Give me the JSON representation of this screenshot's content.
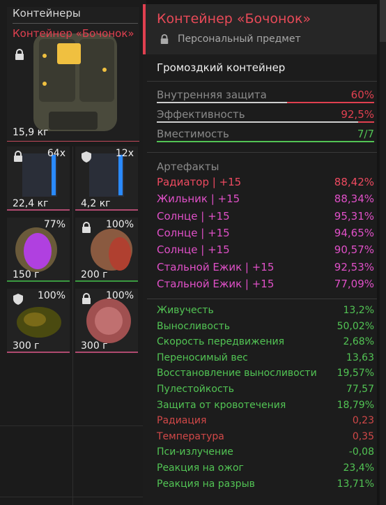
{
  "left": {
    "section_title": "Контейнеры",
    "selected_name": "Контейнер «Бочонок»",
    "selected_weight": "15,9 кг",
    "slots": [
      {
        "weight": "22,4 кг",
        "count": "64x",
        "icon": "lock-icon"
      },
      {
        "weight": "4,2 кг",
        "count": "12x",
        "icon": "shield-icon"
      },
      {
        "weight": "150 г",
        "count": "77%",
        "icon": "none"
      },
      {
        "weight": "200 г",
        "count": "100%",
        "icon": "lock-icon"
      },
      {
        "weight": "300 г",
        "count": "100%",
        "icon": "shield-icon"
      },
      {
        "weight": "300 г",
        "count": "100%",
        "icon": "lock-icon"
      }
    ]
  },
  "panel": {
    "title": "Контейнер «Бочонок»",
    "subtitle": "Персональный предмет",
    "type_label": "Громоздкий контейнер",
    "props": [
      {
        "name": "Внутренняя защита",
        "value": "60%",
        "fill": 0.6,
        "color": "#e04050"
      },
      {
        "name": "Эффективность",
        "value": "92,5%",
        "fill": 0.925,
        "color": "#e04050"
      },
      {
        "name": "Вместимость",
        "value": "7/7",
        "fill": 1.0,
        "color": "#52c454"
      }
    ],
    "artifacts_header": "Артефакты",
    "artifacts": [
      {
        "name": "Радиатор | +15",
        "value": "88,42%",
        "color": "red"
      },
      {
        "name": "Жильник | +15",
        "value": "88,34%",
        "color": "pink"
      },
      {
        "name": "Солнце | +15",
        "value": "95,31%",
        "color": "pink"
      },
      {
        "name": "Солнце | +15",
        "value": "94,65%",
        "color": "pink"
      },
      {
        "name": "Солнце | +15",
        "value": "90,57%",
        "color": "pink"
      },
      {
        "name": "Стальной Ежик | +15",
        "value": "92,53%",
        "color": "pink"
      },
      {
        "name": "Стальной Ежик | +15",
        "value": "77,09%",
        "color": "pink"
      }
    ],
    "stats": [
      {
        "name": "Живучесть",
        "value": "13,2%",
        "color": "green"
      },
      {
        "name": "Выносливость",
        "value": "50,02%",
        "color": "green"
      },
      {
        "name": "Скорость передвижения",
        "value": "2,68%",
        "color": "green"
      },
      {
        "name": "Переносимый вес",
        "value": "13,63",
        "color": "green"
      },
      {
        "name": "Восстановление выносливости",
        "value": "19,57%",
        "color": "green"
      },
      {
        "name": "Пулестойкость",
        "value": "77,57",
        "color": "green"
      },
      {
        "name": "Защита от кровотечения",
        "value": "18,79%",
        "color": "green"
      },
      {
        "name": "Радиация",
        "value": "0,23",
        "color": "red2"
      },
      {
        "name": "Температура",
        "value": "0,35",
        "color": "red2"
      },
      {
        "name": "Пси-излучение",
        "value": "-0,08",
        "color": "green"
      },
      {
        "name": "Реакция на ожог",
        "value": "23,4%",
        "color": "green"
      },
      {
        "name": "Реакция на разрыв",
        "value": "13,71%",
        "color": "green"
      }
    ]
  }
}
